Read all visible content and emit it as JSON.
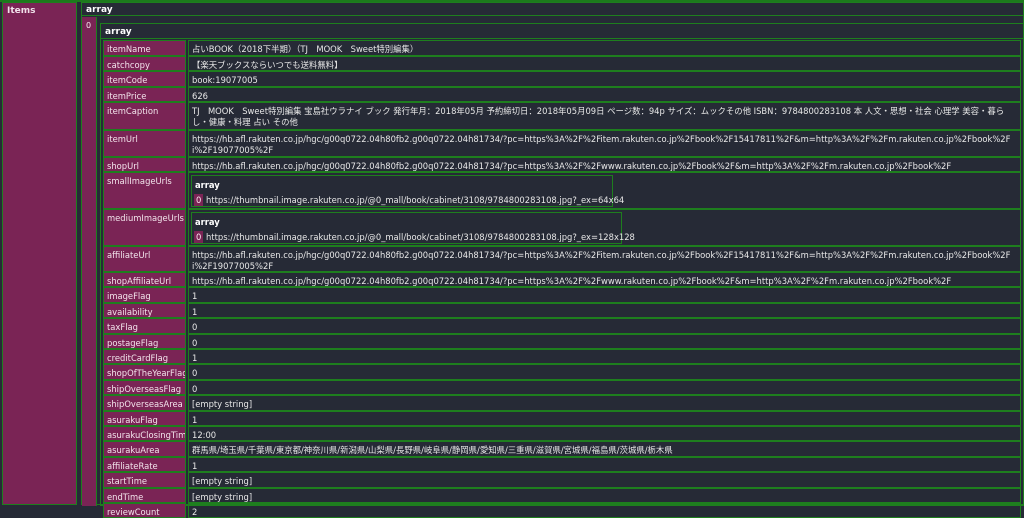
{
  "items_key": "Items",
  "outer": {
    "type_label": "array",
    "index": "0"
  },
  "inner": {
    "type_label": "array"
  },
  "fields": {
    "itemName": {
      "key": "itemName",
      "value": "占いBOOK（2018下半期）（TJ　MOOK　Sweet特別編集）"
    },
    "catchcopy": {
      "key": "catchcopy",
      "value": "【楽天ブックスならいつでも送料無料】"
    },
    "itemCode": {
      "key": "itemCode",
      "value": "book:19077005"
    },
    "itemPrice": {
      "key": "itemPrice",
      "value": "626"
    },
    "itemCaption": {
      "key": "itemCaption",
      "value": "TJ　MOOK　Sweet特別編集 宝島社ウラナイ ブック 発行年月：2018年05月 予約締切日：2018年05月09日 ページ数：94p サイズ：ムックその他 ISBN：9784800283108 本 人文・思想・社会 心理学 美容・暮らし・健康・料理 占い その他"
    },
    "itemUrl": {
      "key": "itemUrl",
      "value": "https://hb.afl.rakuten.co.jp/hgc/g00q0722.04h80fb2.g00q0722.04h81734/?pc=https%3A%2F%2Fitem.rakuten.co.jp%2Fbook%2F15417811%2F&m=http%3A%2F%2Fm.rakuten.co.jp%2Fbook%2Fi%2F19077005%2F"
    },
    "shopUrl": {
      "key": "shopUrl",
      "value": "https://hb.afl.rakuten.co.jp/hgc/g00q0722.04h80fb2.g00q0722.04h81734/?pc=https%3A%2F%2Fwww.rakuten.co.jp%2Fbook%2F&m=http%3A%2F%2Fm.rakuten.co.jp%2Fbook%2F"
    },
    "smallImageUrls": {
      "key": "smallImageUrls",
      "type_label": "array",
      "index": "0",
      "value": "https://thumbnail.image.rakuten.co.jp/@0_mall/book/cabinet/3108/9784800283108.jpg?_ex=64x64"
    },
    "mediumImageUrls": {
      "key": "mediumImageUrls",
      "type_label": "array",
      "index": "0",
      "value": "https://thumbnail.image.rakuten.co.jp/@0_mall/book/cabinet/3108/9784800283108.jpg?_ex=128x128"
    },
    "affiliateUrl": {
      "key": "affiliateUrl",
      "value": "https://hb.afl.rakuten.co.jp/hgc/g00q0722.04h80fb2.g00q0722.04h81734/?pc=https%3A%2F%2Fitem.rakuten.co.jp%2Fbook%2F15417811%2F&m=http%3A%2F%2Fm.rakuten.co.jp%2Fbook%2Fi%2F19077005%2F"
    },
    "shopAffiliateUrl": {
      "key": "shopAffiliateUrl",
      "value": "https://hb.afl.rakuten.co.jp/hgc/g00q0722.04h80fb2.g00q0722.04h81734/?pc=https%3A%2F%2Fwww.rakuten.co.jp%2Fbook%2F&m=http%3A%2F%2Fm.rakuten.co.jp%2Fbook%2F"
    },
    "imageFlag": {
      "key": "imageFlag",
      "value": "1"
    },
    "availability": {
      "key": "availability",
      "value": "1"
    },
    "taxFlag": {
      "key": "taxFlag",
      "value": "0"
    },
    "postageFlag": {
      "key": "postageFlag",
      "value": "0"
    },
    "creditCardFlag": {
      "key": "creditCardFlag",
      "value": "1"
    },
    "shopOfTheYearFlag": {
      "key": "shopOfTheYearFlag",
      "value": "0"
    },
    "shipOverseasFlag": {
      "key": "shipOverseasFlag",
      "value": "0"
    },
    "shipOverseasArea": {
      "key": "shipOverseasArea",
      "value": "[empty string]"
    },
    "asurakuFlag": {
      "key": "asurakuFlag",
      "value": "1"
    },
    "asurakuClosingTime": {
      "key": "asurakuClosingTime",
      "value": "12:00"
    },
    "asurakuArea": {
      "key": "asurakuArea",
      "value": "群馬県/埼玉県/千葉県/東京都/神奈川県/新潟県/山梨県/長野県/岐阜県/静岡県/愛知県/三重県/滋賀県/宮城県/福島県/茨城県/栃木県"
    },
    "affiliateRate": {
      "key": "affiliateRate",
      "value": "1"
    },
    "startTime": {
      "key": "startTime",
      "value": "[empty string]"
    },
    "endTime": {
      "key": "endTime",
      "value": "[empty string]"
    },
    "reviewCount": {
      "key": "reviewCount",
      "value": "2"
    }
  }
}
